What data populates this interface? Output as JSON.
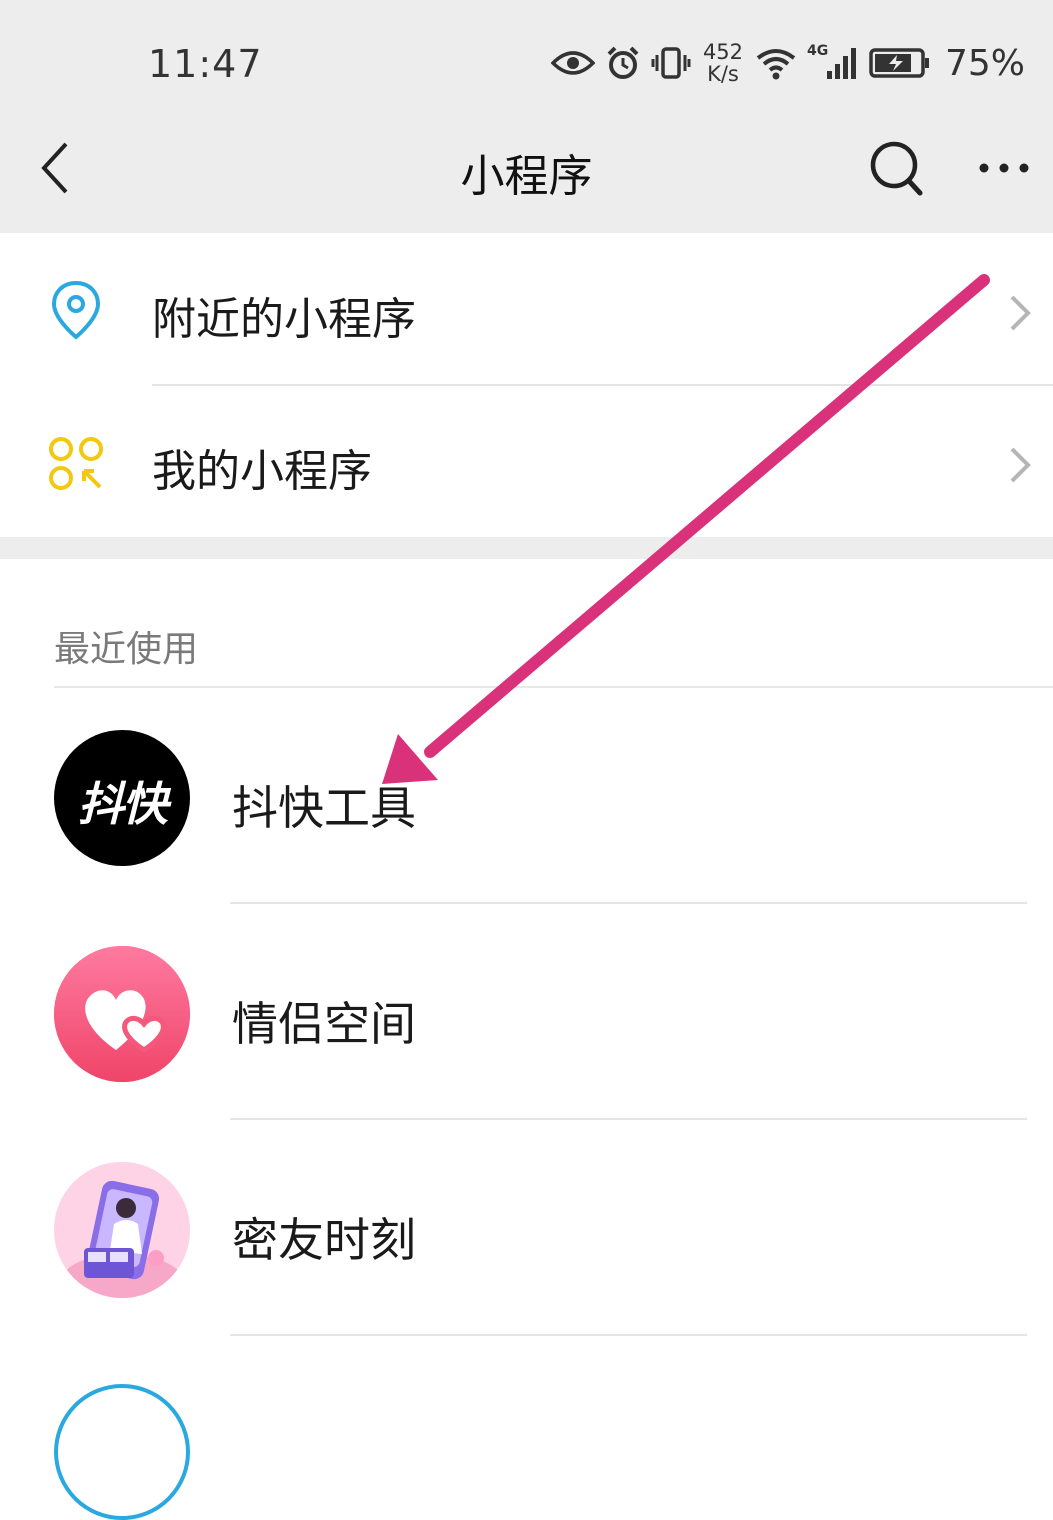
{
  "status_bar": {
    "time": "11:47",
    "net_speed_value": "452",
    "net_speed_unit": "K/s",
    "network_type": "4G",
    "battery_percent": "75%"
  },
  "nav": {
    "title": "小程序",
    "back_icon": "chevron-left-icon",
    "search_icon": "search-icon",
    "more_icon": "more-horizontal-icon"
  },
  "menu": [
    {
      "label": "附近的小程序",
      "icon": "location-pin-icon",
      "icon_color": "#2aa9e0"
    },
    {
      "label": "我的小程序",
      "icon": "mini-program-grid-icon",
      "icon_color": "#f2c811"
    }
  ],
  "recent": {
    "section_title": "最近使用",
    "items": [
      {
        "label": "抖快工具",
        "icon_text": "抖快",
        "icon_bg": "#000000"
      },
      {
        "label": "情侣空间",
        "icon": "hearts-icon",
        "icon_bg": "#f5587b"
      },
      {
        "label": "密友时刻",
        "icon": "illustration-avatar-icon",
        "icon_bg": "#ffd3e6"
      }
    ]
  },
  "colors": {
    "annotation_arrow": "#d9327a",
    "nav_background": "#ededed"
  }
}
